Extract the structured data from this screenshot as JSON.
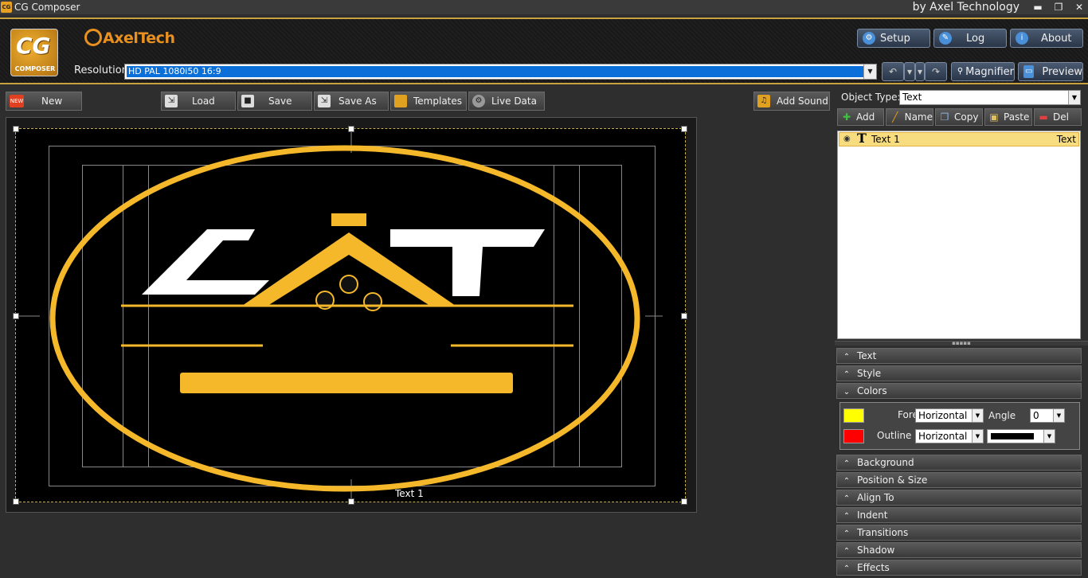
{
  "window": {
    "title": "CG Composer",
    "vendor": "by Axel Technology"
  },
  "header": {
    "logo_big": "CG",
    "logo_small": "COMPOSER",
    "brand_a": "Axel",
    "brand_b": "Tech",
    "setup": "Setup",
    "log": "Log",
    "about": "About",
    "resolution_label": "Resolution",
    "resolution_value": "HD PAL 1080i50 16:9",
    "magnifier": "Magnifier",
    "preview": "Preview"
  },
  "toolbar": {
    "new_badge": "NEW",
    "new": "New",
    "load": "Load",
    "save": "Save",
    "save_as": "Save As",
    "templates": "Templates",
    "live_data": "Live Data",
    "add_sound": "Add Sound"
  },
  "canvas": {
    "caption": "Text 1"
  },
  "objects": {
    "type_label": "Object Type:",
    "type_value": "Text",
    "add": "Add",
    "name": "Name",
    "copy": "Copy",
    "paste": "Paste",
    "del": "Del",
    "items": [
      {
        "name": "Text 1",
        "type": "Text"
      }
    ]
  },
  "sections": {
    "text": "Text",
    "style": "Style",
    "colors": "Colors",
    "background": "Background",
    "position_size": "Position & Size",
    "align_to": "Align To",
    "indent": "Indent",
    "transitions": "Transitions",
    "shadow": "Shadow",
    "effects": "Effects"
  },
  "colors": {
    "fore_label": "Fore",
    "fore_color": "#ffff00",
    "fore_mode": "Horizontal",
    "angle_label": "Angle",
    "angle_value": "0",
    "outline_label": "Outline",
    "outline_color": "#ff0000",
    "outline_mode": "Horizontal",
    "outline_swatch": "#000000"
  }
}
